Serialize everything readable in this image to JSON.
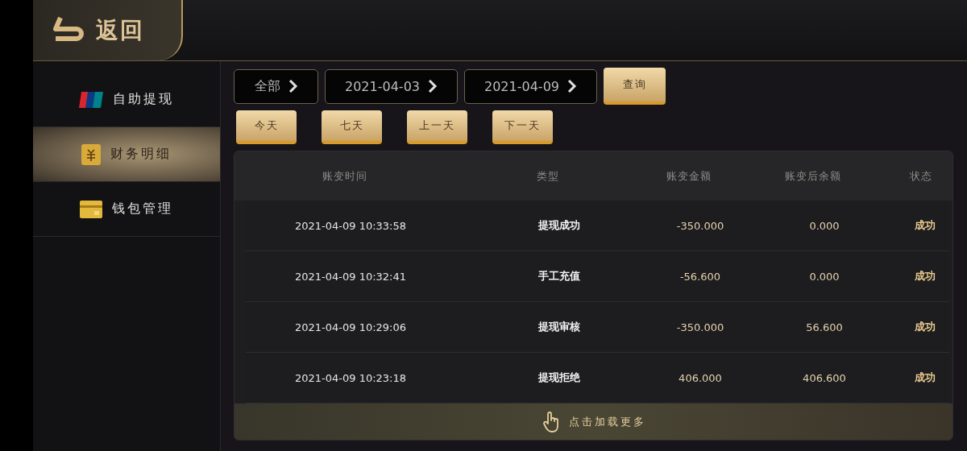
{
  "header": {
    "back_label": "返回"
  },
  "sidebar": {
    "items": [
      {
        "label": "自助提现",
        "selected": false
      },
      {
        "label": "财务明细",
        "selected": true
      },
      {
        "label": "钱包管理",
        "selected": false
      }
    ]
  },
  "filters": [
    {
      "value": "全部"
    },
    {
      "value": "2021-04-03"
    },
    {
      "value": "2021-04-09"
    }
  ],
  "query_button": "查询",
  "quick_buttons": [
    "今天",
    "七天",
    "上一天",
    "下一天"
  ],
  "table": {
    "columns": [
      "账变时间",
      "类型",
      "账变金额",
      "账变后余额",
      "状态"
    ],
    "rows": [
      [
        "2021-04-09 10:33:58",
        "提现成功",
        "-350.000",
        "0.000",
        "成功"
      ],
      [
        "2021-04-09 10:32:41",
        "手工充值",
        "-56.600",
        "0.000",
        "成功"
      ],
      [
        "2021-04-09 10:29:06",
        "提现审核",
        "-350.000",
        "56.600",
        "成功"
      ],
      [
        "2021-04-09 10:23:18",
        "提现拒绝",
        "406.000",
        "406.600",
        "成功"
      ]
    ]
  },
  "load_more": "点击加载更多"
}
